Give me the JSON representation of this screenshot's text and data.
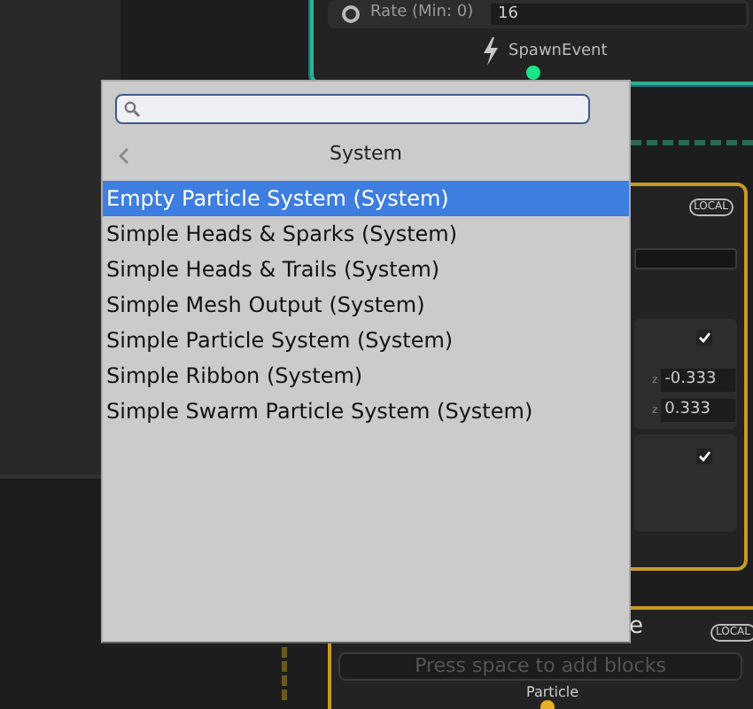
{
  "spawn_node": {
    "rate_label": "Rate (Min: 0)",
    "rate_value": "16",
    "event": "SpawnEvent"
  },
  "init_node": {
    "badge": "LOCAL",
    "toggles": [
      {
        "checked": true
      },
      {
        "checked": true
      }
    ],
    "z_fields": [
      {
        "axis": "z",
        "value": "-0.333"
      },
      {
        "axis": "z",
        "value": "0.333"
      }
    ]
  },
  "output_node": {
    "title": "e",
    "badge": "LOCAL",
    "placeholder": "Press space to add blocks",
    "flow": "Particle"
  },
  "popup": {
    "header": "System",
    "items": [
      {
        "label": "Empty Particle System (System)",
        "selected": true
      },
      {
        "label": "Simple Heads & Sparks (System)",
        "selected": false
      },
      {
        "label": "Simple Heads & Trails (System)",
        "selected": false
      },
      {
        "label": "Simple Mesh Output (System)",
        "selected": false
      },
      {
        "label": "Simple Particle System (System)",
        "selected": false
      },
      {
        "label": "Simple Ribbon (System)",
        "selected": false
      },
      {
        "label": "Simple Swarm Particle System (System)",
        "selected": false
      }
    ]
  }
}
